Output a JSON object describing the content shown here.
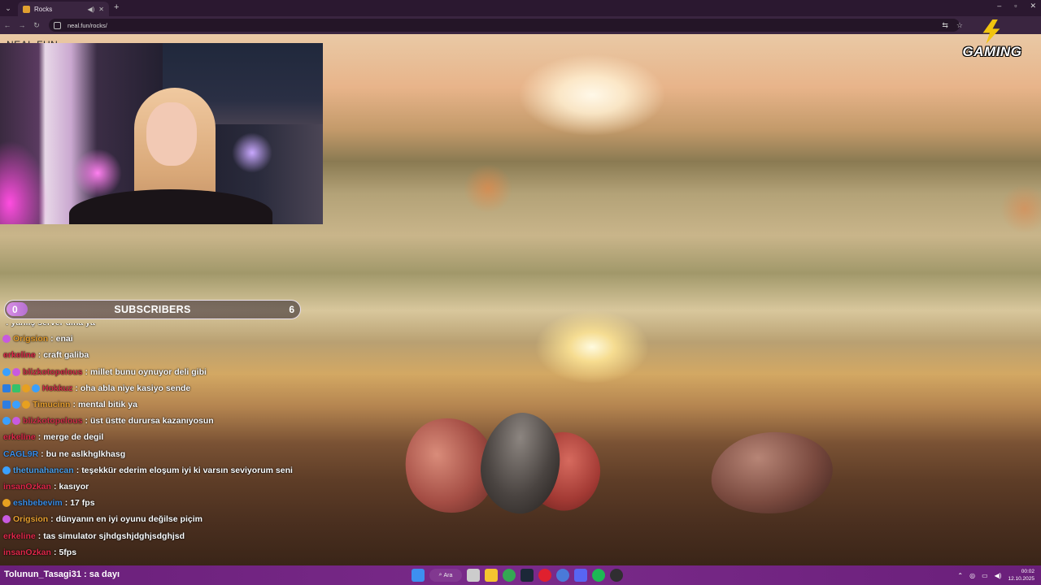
{
  "browser": {
    "tab_title": "Rocks",
    "tab_mute_icon": "speaker-icon",
    "new_tab_label": "+",
    "url": "neal.fun/rocks/",
    "window_controls": [
      "–",
      "▫",
      "✕"
    ]
  },
  "site": {
    "brand": "NEAL.FUN"
  },
  "subscribers": {
    "current": "0",
    "label": "SUBSCRIBERS",
    "goal": "6",
    "progress_fraction": 0.05
  },
  "logo": {
    "text": "GAMING"
  },
  "chat": [
    {
      "user": "",
      "user_color": "#4a90e2",
      "badges": [],
      "text": "yanlış server dina ya"
    },
    {
      "user": "Origsion",
      "user_color": "#e8a030",
      "badges": [
        "sub"
      ],
      "text": "enai"
    },
    {
      "user": "erkeline",
      "user_color": "#e0284a",
      "badges": [],
      "text": "craft galiba"
    },
    {
      "user": "blizkotopelous",
      "user_color": "#d0304a",
      "badges": [
        "prime",
        "sub"
      ],
      "text": "millet bunu oynuyor deli gibi"
    },
    {
      "user": "Hokkuz",
      "user_color": "#d0304a",
      "badges": [
        "blue",
        "green",
        "vip",
        "prime"
      ],
      "text": "oha abla niye kasiyo sende"
    },
    {
      "user": "Timucinn",
      "user_color": "#e8a030",
      "badges": [
        "blue",
        "prime",
        "vip"
      ],
      "text": "mental bitik ya"
    },
    {
      "user": "blizkotopelous",
      "user_color": "#d0304a",
      "badges": [
        "prime",
        "sub"
      ],
      "text": "üst üstte durursa kazanıyosun"
    },
    {
      "user": "erkeline",
      "user_color": "#e0284a",
      "badges": [],
      "text": "merge de degil"
    },
    {
      "user": "CAGL9R",
      "user_color": "#3a8ee8",
      "badges": [],
      "text": "bu ne aslkhglkhasg"
    },
    {
      "user": "thetunahancan",
      "user_color": "#4a9ee8",
      "badges": [
        "prime"
      ],
      "text": "teşekkür ederim eloşum iyi ki varsın seviyorum seni"
    },
    {
      "user": "insanOzkan",
      "user_color": "#e0284a",
      "badges": [],
      "text": "kasıyor"
    },
    {
      "user": "eshbebevim",
      "user_color": "#3a8ee8",
      "badges": [
        "vip"
      ],
      "text": "17 fps"
    },
    {
      "user": "Origsion",
      "user_color": "#e8a030",
      "badges": [
        "sub"
      ],
      "text": "dünyanın en iyi oyunu değilse piçim"
    },
    {
      "user": "erkeline",
      "user_color": "#e0284a",
      "badges": [],
      "text": "tas simulator sjhdgshjdghjsdghjsd"
    },
    {
      "user": "insanOzkan",
      "user_color": "#e0284a",
      "badges": [],
      "text": "5fps"
    }
  ],
  "ticker": {
    "text": "Tolunun_Tasagi31 : sa dayı"
  },
  "taskbar": {
    "search_label": "Ara",
    "time": "00:02",
    "date": "12.10.2025"
  }
}
